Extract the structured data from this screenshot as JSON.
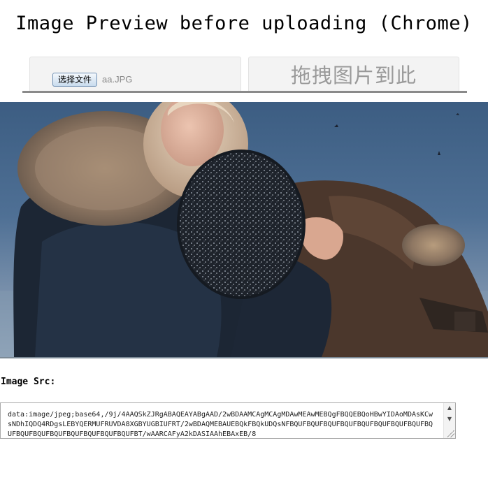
{
  "page": {
    "title": "Image Preview before uploading (Chrome)"
  },
  "uploader": {
    "file_button_label": "选择文件",
    "file_name": "aa.JPG",
    "drop_zone_label": "拖拽图片到此"
  },
  "image_src": {
    "label": "Image Src:",
    "value": "data:image/jpeg;base64,/9j/4AAQSkZJRgABAQEAYABgAAD/2wBDAAMCAgMCAgMDAwMEAwMEBQgFBQQEBQoHBwYIDAoMDAsKCwsNDhIQDQ4RDgsLEBYQERMUFRUVDA8XGBYUGBIUFRT/2wBDAQMEBAUEBQkFBQkUDQsNFBQUFBQUFBQUFBQUFBQUFBQUFBQUFBQUFBQUFBQUFBQUFBQUFBQUFBQUFBQUFBQUFBT/wAARCAFyA2kDASIAAhEBAxEB/8"
  },
  "colors": {
    "drop_text": "#9a9a9a",
    "file_name_text": "#8a8a8a",
    "divider": "#8a8a8a"
  }
}
